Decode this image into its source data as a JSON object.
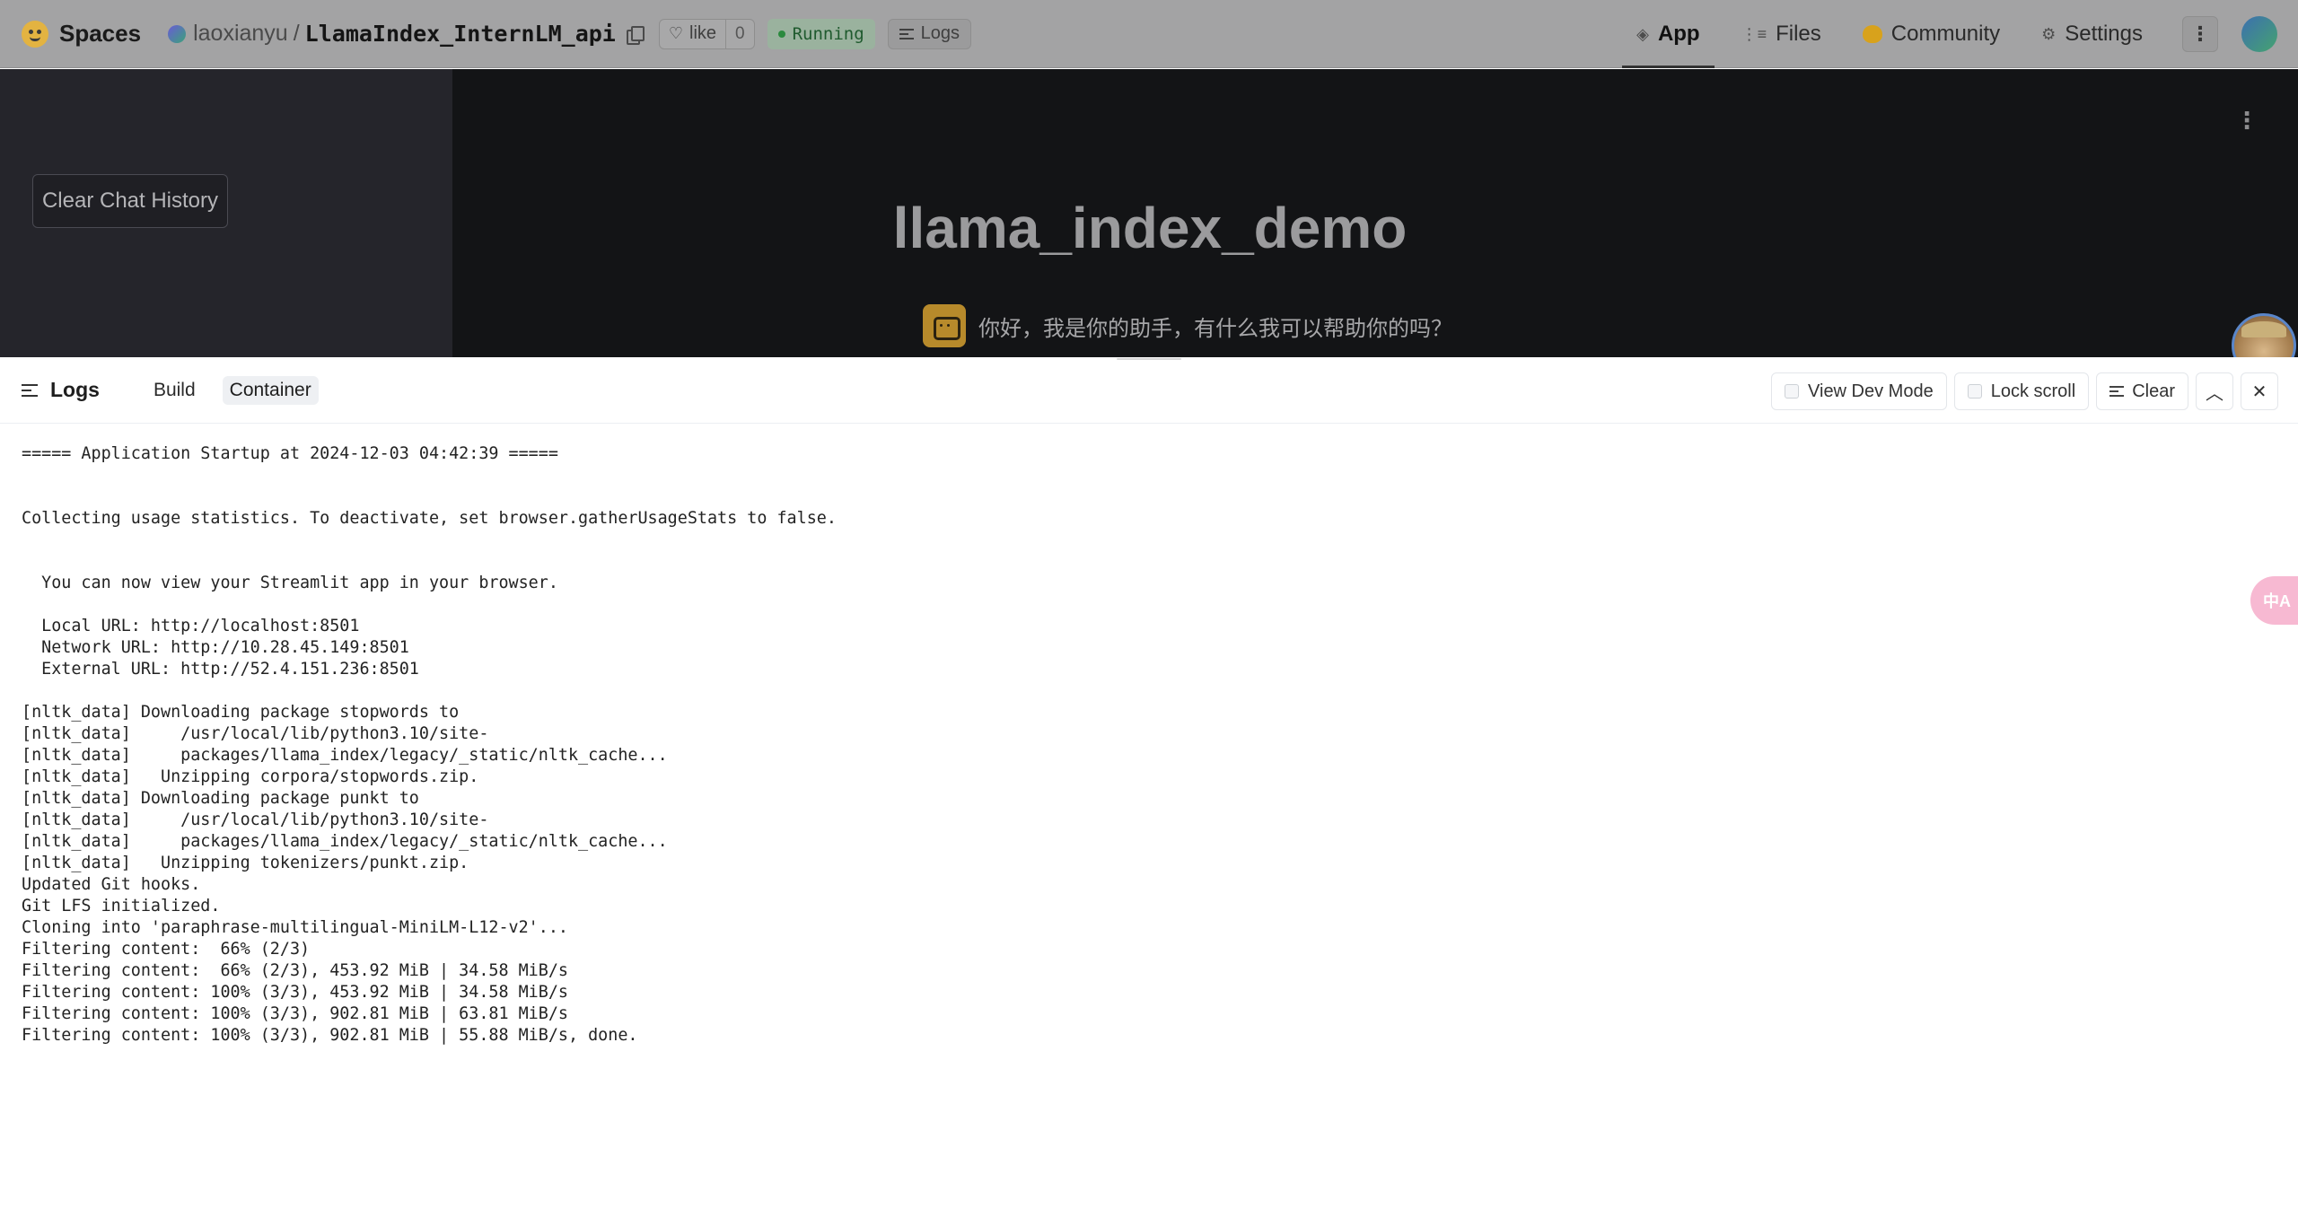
{
  "topbar": {
    "brand": "Spaces",
    "owner": "laoxianyu",
    "separator": "/",
    "repo_name": "LlamaIndex_InternLM_api",
    "like_label": "like",
    "like_count": "0",
    "status": "Running",
    "logs_label": "Logs",
    "nav": {
      "app": "App",
      "files": "Files",
      "community": "Community",
      "settings": "Settings"
    },
    "more_glyph": "⋮"
  },
  "app": {
    "clear_button": "Clear Chat History",
    "title": "llama_index_demo",
    "assistant_message": "你好，我是你的助手，有什么我可以帮助你的吗？",
    "menu_glyph": "⋮"
  },
  "logs": {
    "title": "Logs",
    "tabs": [
      "Build",
      "Container"
    ],
    "active_tab": "Container",
    "actions": {
      "view_dev_mode": "View Dev Mode",
      "lock_scroll": "Lock scroll",
      "clear": "Clear",
      "collapse_glyph": "︿",
      "close_glyph": "✕"
    },
    "lines": [
      "===== Application Startup at 2024-12-03 04:42:39 =====",
      "",
      "",
      "Collecting usage statistics. To deactivate, set browser.gatherUsageStats to false.",
      "",
      "",
      "  You can now view your Streamlit app in your browser.",
      "",
      "  Local URL: http://localhost:8501",
      "  Network URL: http://10.28.45.149:8501",
      "  External URL: http://52.4.151.236:8501",
      "",
      "[nltk_data] Downloading package stopwords to",
      "[nltk_data]     /usr/local/lib/python3.10/site-",
      "[nltk_data]     packages/llama_index/legacy/_static/nltk_cache...",
      "[nltk_data]   Unzipping corpora/stopwords.zip.",
      "[nltk_data] Downloading package punkt to",
      "[nltk_data]     /usr/local/lib/python3.10/site-",
      "[nltk_data]     packages/llama_index/legacy/_static/nltk_cache...",
      "[nltk_data]   Unzipping tokenizers/punkt.zip.",
      "Updated Git hooks.",
      "Git LFS initialized.",
      "Cloning into 'paraphrase-multilingual-MiniLM-L12-v2'...",
      "Filtering content:  66% (2/3)",
      "Filtering content:  66% (2/3), 453.92 MiB | 34.58 MiB/s",
      "Filtering content: 100% (3/3), 453.92 MiB | 34.58 MiB/s",
      "Filtering content: 100% (3/3), 902.81 MiB | 63.81 MiB/s",
      "Filtering content: 100% (3/3), 902.81 MiB | 55.88 MiB/s, done."
    ]
  },
  "translate_fab": "中A",
  "colors": {
    "topbar_bg": "#a3a3a4",
    "app_bg": "#131416",
    "sidebar_bg": "#25252b",
    "status_green": "#2b8a3e",
    "community_yellow": "#d8a21c"
  }
}
